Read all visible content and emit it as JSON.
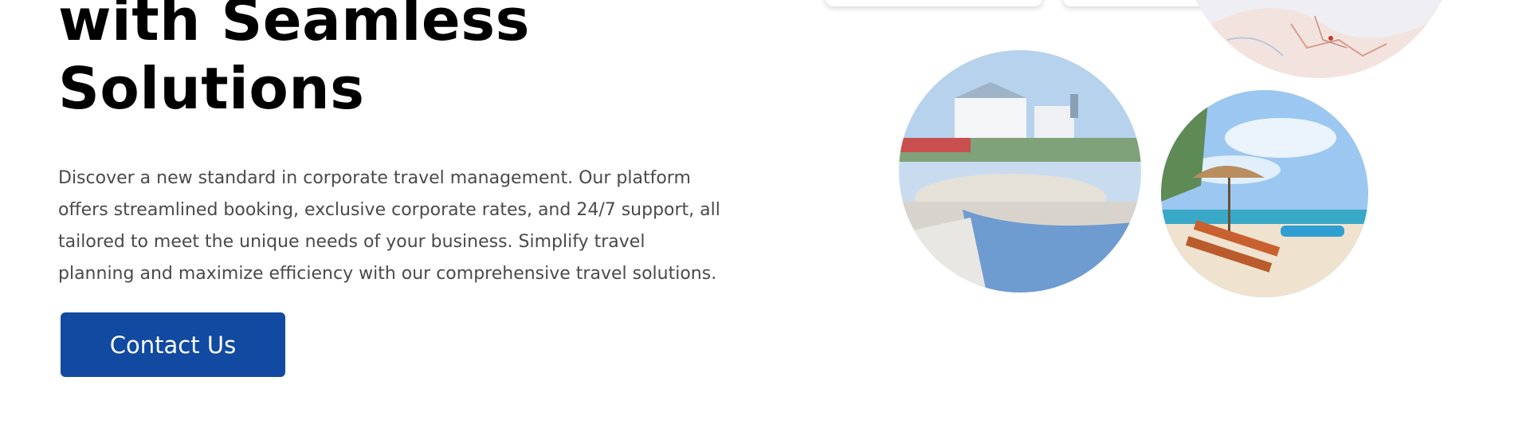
{
  "hero": {
    "headline_lines": [
      "with Seamless",
      "Solutions"
    ],
    "description_lines": [
      "Discover a new standard in corporate travel management. Our platform",
      "offers streamlined booking, exclusive corporate rates, and 24/7 support, all",
      "tailored to meet the unique needs of your business. Simplify travel",
      "planning and maximize efficiency with our comprehensive travel solutions."
    ],
    "cta_label": "Contact Us"
  },
  "colors": {
    "cta_background": "#114aa0",
    "cta_text": "#ffffff",
    "headline": "#000000",
    "body_text": "#4a4a4a"
  },
  "images": [
    "map-image",
    "resort-pool-image",
    "beach-umbrella-image"
  ]
}
